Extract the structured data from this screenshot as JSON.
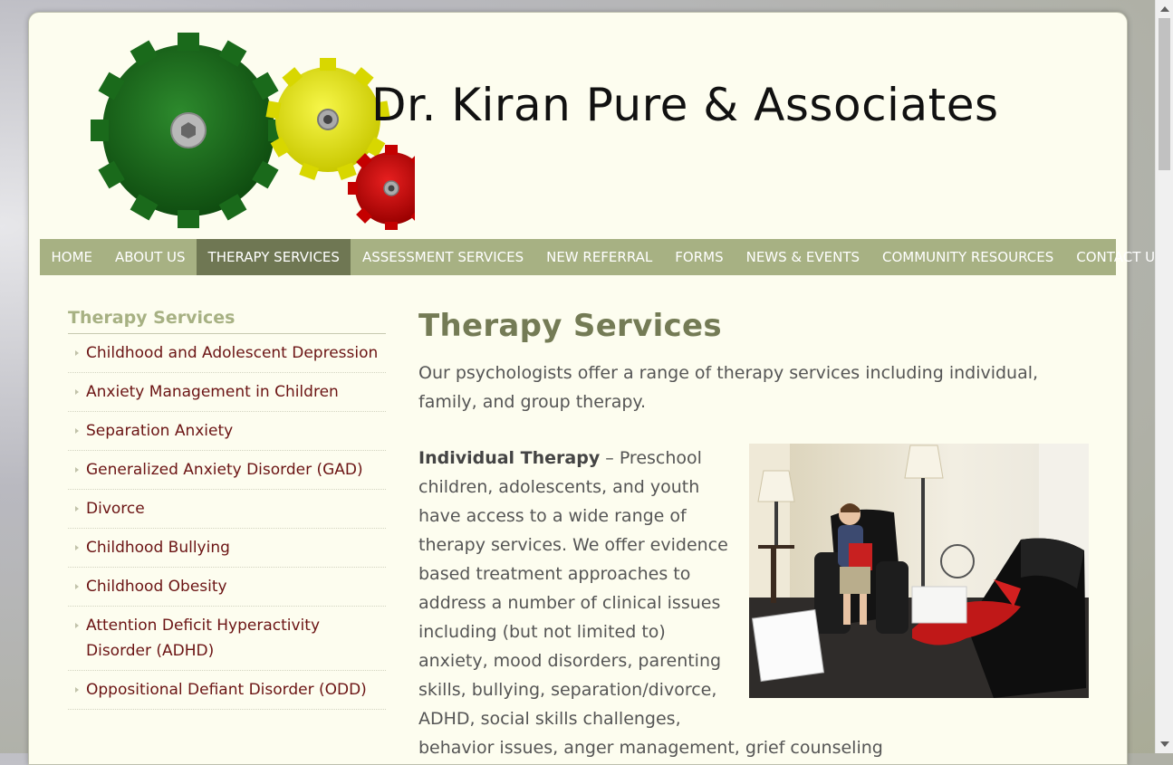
{
  "header": {
    "site_title": "Dr. Kiran Pure & Associates"
  },
  "nav": {
    "items": [
      {
        "label": "HOME"
      },
      {
        "label": "ABOUT US"
      },
      {
        "label": "THERAPY SERVICES"
      },
      {
        "label": "ASSESSMENT SERVICES"
      },
      {
        "label": "NEW REFERRAL"
      },
      {
        "label": "FORMS"
      },
      {
        "label": "NEWS & EVENTS"
      },
      {
        "label": "COMMUNITY RESOURCES"
      },
      {
        "label": "CONTACT US"
      }
    ],
    "active": "THERAPY SERVICES"
  },
  "sidebar": {
    "title": "Therapy Services",
    "items": [
      {
        "label": "Childhood and Adolescent Depression"
      },
      {
        "label": "Anxiety Management in Children"
      },
      {
        "label": "Separation Anxiety"
      },
      {
        "label": "Generalized Anxiety Disorder (GAD)"
      },
      {
        "label": "Divorce"
      },
      {
        "label": "Childhood Bullying"
      },
      {
        "label": "Childhood Obesity"
      },
      {
        "label": "Attention Deficit Hyperactivity Disorder (ADHD)"
      },
      {
        "label": "Oppositional Defiant Disorder (ODD)"
      }
    ]
  },
  "main": {
    "title": "Therapy Services",
    "intro": "Our psychologists offer a range of therapy services including individual, family, and group therapy.",
    "individual_label": "Individual Therapy",
    "individual_text": " – Preschool children, adolescents, and youth have access to a wide range of therapy services. We offer evidence based treatment approaches to address a number of clinical issues including (but not limited to) anxiety, mood disorders, parenting skills, bullying, separation/divorce, ADHD, social skills challenges, behavior issues, anger management, grief counseling"
  },
  "colors": {
    "nav_bg": "#a7b183",
    "nav_active": "#6f7753",
    "heading": "#747b55",
    "link": "#6b1414",
    "page_bg": "#fdfdef"
  }
}
